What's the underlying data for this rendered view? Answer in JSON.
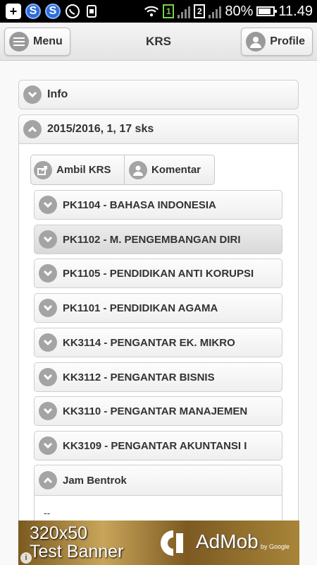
{
  "status_bar": {
    "sim1": "1",
    "sim2": "2",
    "battery": "80%",
    "time": "11.49"
  },
  "header": {
    "menu_label": "Menu",
    "title": "KRS",
    "profile_label": "Profile"
  },
  "sections": {
    "info_label": "Info",
    "semester_label": "2015/2016, 1, 17 sks"
  },
  "actions": {
    "ambil_label": "Ambil KRS",
    "komentar_label": "Komentar"
  },
  "courses": [
    "PK1104 - BAHASA INDONESIA",
    "PK1102 - M. PENGEMBANGAN DIRI",
    "PK1105 - PENDIDIKAN ANTI KORUPSI",
    "PK1101 - PENDIDIKAN AGAMA",
    "KK3114 - PENGANTAR EK. MIKRO",
    "KK3112 - PENGANTAR BISNIS",
    "KK3110 - PENGANTAR MANAJEMEN",
    "KK3109 - PENGANTAR AKUNTANSI I"
  ],
  "jam_bentrok": {
    "label": "Jam Bentrok",
    "text": "--"
  },
  "ad": {
    "size_text": "320x50",
    "label": "Test Banner",
    "brand": "AdMob",
    "by": "by Google",
    "info_icon": "i"
  },
  "colors": {
    "icon_gray": "#a4a4a4",
    "header_bg": "#eaeaea"
  }
}
